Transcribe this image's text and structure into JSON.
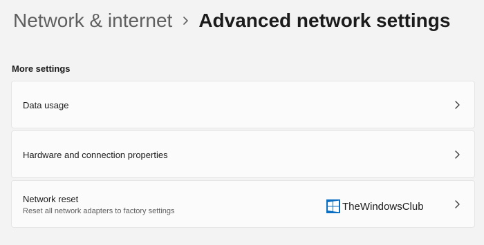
{
  "breadcrumb": {
    "parent": "Network & internet",
    "current": "Advanced network settings"
  },
  "section": {
    "title": "More settings"
  },
  "items": [
    {
      "title": "Data usage"
    },
    {
      "title": "Hardware and connection properties"
    },
    {
      "title": "Network reset",
      "subtitle": "Reset all network adapters to factory settings"
    }
  ],
  "watermark": {
    "text": "TheWindowsClub"
  },
  "colors": {
    "background": "#f3f3f3",
    "card": "#fbfbfb",
    "card_border": "#e5e5e5",
    "watermark_blue": "#0a6fc2"
  },
  "icons": {
    "breadcrumb_separator": "chevron-right-icon",
    "row_chevron": "chevron-right-icon",
    "watermark_logo": "windows-logo-icon"
  }
}
